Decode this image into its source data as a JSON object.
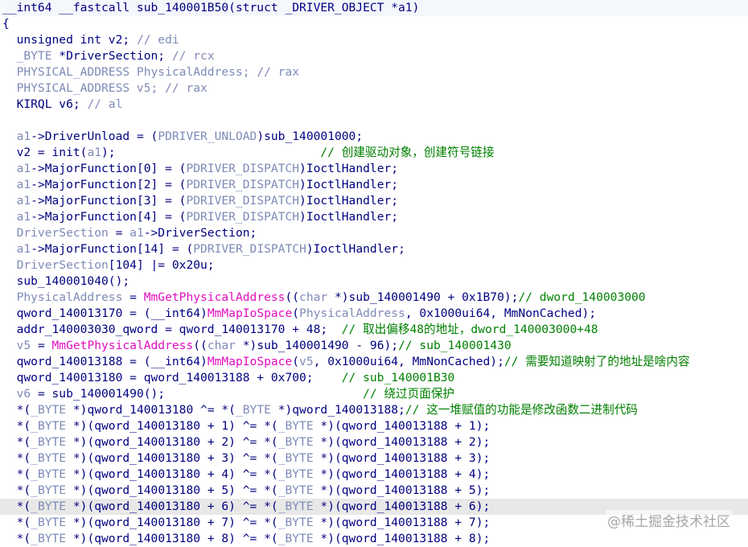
{
  "lines": [
    [
      [
        "kw",
        "__int64 __fastcall sub_140001B50(struct _DRIVER_OBJECT *a1)"
      ]
    ],
    [
      [
        "pn",
        "{"
      ]
    ],
    [
      [
        "kw",
        "  unsigned int v2; "
      ],
      [
        "cmr",
        "// edi"
      ]
    ],
    [
      [
        "typ",
        "  _BYTE "
      ],
      [
        "kw",
        "*DriverSection; "
      ],
      [
        "cmr",
        "// rcx"
      ]
    ],
    [
      [
        "typ",
        "  PHYSICAL_ADDRESS PhysicalAddress; "
      ],
      [
        "cmr",
        "// rax"
      ]
    ],
    [
      [
        "typ",
        "  PHYSICAL_ADDRESS v5; "
      ],
      [
        "cmr",
        "// rax"
      ]
    ],
    [
      [
        "kw",
        "  KIRQL v6; "
      ],
      [
        "cmr",
        "// al"
      ]
    ],
    [],
    [
      [
        "var",
        "  a1"
      ],
      [
        "kw",
        "->DriverUnload = ("
      ],
      [
        "typ",
        "PDRIVER_UNLOAD"
      ],
      [
        "kw",
        ")sub_140001000;"
      ]
    ],
    [
      [
        "kw",
        "  v2 = init("
      ],
      [
        "var",
        "a1"
      ],
      [
        "kw",
        ");                             "
      ],
      [
        "cm",
        "// 创建驱动对象，创建符号链接"
      ]
    ],
    [
      [
        "var",
        "  a1"
      ],
      [
        "kw",
        "->MajorFunction[0] = ("
      ],
      [
        "typ",
        "PDRIVER_DISPATCH"
      ],
      [
        "kw",
        ")IoctlHandler;"
      ]
    ],
    [
      [
        "var",
        "  a1"
      ],
      [
        "kw",
        "->MajorFunction[2] = ("
      ],
      [
        "typ",
        "PDRIVER_DISPATCH"
      ],
      [
        "kw",
        ")IoctlHandler;"
      ]
    ],
    [
      [
        "var",
        "  a1"
      ],
      [
        "kw",
        "->MajorFunction[3] = ("
      ],
      [
        "typ",
        "PDRIVER_DISPATCH"
      ],
      [
        "kw",
        ")IoctlHandler;"
      ]
    ],
    [
      [
        "var",
        "  a1"
      ],
      [
        "kw",
        "->MajorFunction[4] = ("
      ],
      [
        "typ",
        "PDRIVER_DISPATCH"
      ],
      [
        "kw",
        ")IoctlHandler;"
      ]
    ],
    [
      [
        "var",
        "  DriverSection"
      ],
      [
        "kw",
        " = "
      ],
      [
        "var",
        "a1"
      ],
      [
        "kw",
        "->DriverSection;"
      ]
    ],
    [
      [
        "var",
        "  a1"
      ],
      [
        "kw",
        "->MajorFunction[14] = ("
      ],
      [
        "typ",
        "PDRIVER_DISPATCH"
      ],
      [
        "kw",
        ")IoctlHandler;"
      ]
    ],
    [
      [
        "var",
        "  DriverSection"
      ],
      [
        "kw",
        "[104] |= 0x20u;"
      ]
    ],
    [
      [
        "kw",
        "  sub_140001040();"
      ]
    ],
    [
      [
        "var",
        "  PhysicalAddress"
      ],
      [
        "kw",
        " = "
      ],
      [
        "api",
        "MmGetPhysicalAddress"
      ],
      [
        "kw",
        "(("
      ],
      [
        "typ",
        "char"
      ],
      [
        "kw",
        " *)sub_140001490 + 0x1B70);"
      ],
      [
        "cm",
        "// dword_140003000"
      ]
    ],
    [
      [
        "kw",
        "  qword_140013170 = (__int64)"
      ],
      [
        "api",
        "MmMapIoSpace"
      ],
      [
        "kw",
        "("
      ],
      [
        "var",
        "PhysicalAddress"
      ],
      [
        "kw",
        ", 0x1000ui64, MmNonCached);"
      ]
    ],
    [
      [
        "kw",
        "  addr_140003030_qword = qword_140013170 + 48;  "
      ],
      [
        "cm",
        "// 取出偏移48的地址，dword_140003000+48"
      ]
    ],
    [
      [
        "var",
        "  v5"
      ],
      [
        "kw",
        " = "
      ],
      [
        "api",
        "MmGetPhysicalAddress"
      ],
      [
        "kw",
        "(("
      ],
      [
        "typ",
        "char"
      ],
      [
        "kw",
        " *)sub_140001490 - 96);"
      ],
      [
        "cm",
        "// sub_140001430"
      ]
    ],
    [
      [
        "kw",
        "  qword_140013188 = (__int64)"
      ],
      [
        "api",
        "MmMapIoSpace"
      ],
      [
        "kw",
        "("
      ],
      [
        "var",
        "v5"
      ],
      [
        "kw",
        ", 0x1000ui64, MmNonCached);"
      ],
      [
        "cm",
        "// 需要知道映射了的地址是啥内容"
      ]
    ],
    [
      [
        "kw",
        "  qword_140013180 = qword_140013188 + 0x700;    "
      ],
      [
        "cm",
        "// sub_140001B30"
      ]
    ],
    [
      [
        "var",
        "  v6"
      ],
      [
        "kw",
        " = sub_140001490();                            "
      ],
      [
        "cm",
        "// 绕过页面保护"
      ]
    ],
    [
      [
        "kw",
        "  *("
      ],
      [
        "typ",
        "_BYTE"
      ],
      [
        "kw",
        " *)qword_140013180 ^= *("
      ],
      [
        "typ",
        "_BYTE"
      ],
      [
        "kw",
        " *)qword_140013188;"
      ],
      [
        "cm",
        "// 这一堆赋值的功能是修改函数二进制代码"
      ]
    ],
    [
      [
        "kw",
        "  *("
      ],
      [
        "typ",
        "_BYTE"
      ],
      [
        "kw",
        " *)(qword_140013180 + 1) ^= *("
      ],
      [
        "typ",
        "_BYTE"
      ],
      [
        "kw",
        " *)(qword_140013188 + 1);"
      ]
    ],
    [
      [
        "kw",
        "  *("
      ],
      [
        "typ",
        "_BYTE"
      ],
      [
        "kw",
        " *)(qword_140013180 + 2) ^= *("
      ],
      [
        "typ",
        "_BYTE"
      ],
      [
        "kw",
        " *)(qword_140013188 + 2);"
      ]
    ],
    [
      [
        "kw",
        "  *("
      ],
      [
        "typ",
        "_BYTE"
      ],
      [
        "kw",
        " *)(qword_140013180 + 3) ^= *("
      ],
      [
        "typ",
        "_BYTE"
      ],
      [
        "kw",
        " *)(qword_140013188 + 3);"
      ]
    ],
    [
      [
        "kw",
        "  *("
      ],
      [
        "typ",
        "_BYTE"
      ],
      [
        "kw",
        " *)(qword_140013180 + 4) ^= *("
      ],
      [
        "typ",
        "_BYTE"
      ],
      [
        "kw",
        " *)(qword_140013188 + 4);"
      ]
    ],
    [
      [
        "kw",
        "  *("
      ],
      [
        "typ",
        "_BYTE"
      ],
      [
        "kw",
        " *)(qword_140013180 + 5) ^= *("
      ],
      [
        "typ",
        "_BYTE"
      ],
      [
        "kw",
        " *)(qword_140013188 + 5);"
      ]
    ],
    [
      [
        "kw",
        "  *("
      ],
      [
        "typ",
        "_BYTE"
      ],
      [
        "kw",
        " *)(qword_140013180 + 6) ^= *("
      ],
      [
        "typ",
        "_BYTE"
      ],
      [
        "kw",
        " *)(qword_140013188 + 6);"
      ]
    ],
    [
      [
        "kw",
        "  *("
      ],
      [
        "typ",
        "_BYTE"
      ],
      [
        "kw",
        " *)(qword_140013180 + 7) ^= *("
      ],
      [
        "typ",
        "_BYTE"
      ],
      [
        "kw",
        " *)(qword_140013188 + 7);"
      ]
    ],
    [
      [
        "kw",
        "  *("
      ],
      [
        "typ",
        "_BYTE"
      ],
      [
        "kw",
        " *)(qword_140013180 + 8) ^= *("
      ],
      [
        "typ",
        "_BYTE"
      ],
      [
        "kw",
        " *)(qword_140013188 + 8);"
      ]
    ]
  ],
  "highlighted_line": 31,
  "colors": {
    "text": "#000080",
    "variable": "#7f8ab6",
    "api": "#e00fbd",
    "comment": "#008000",
    "highlight": "#e8e8e8"
  },
  "watermark": "@稀土掘金技术社区"
}
